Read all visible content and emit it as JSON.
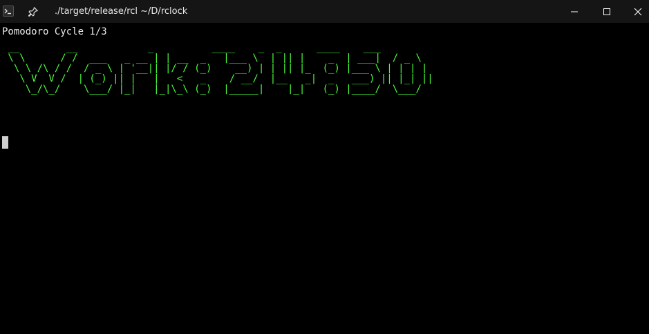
{
  "window": {
    "title": "./target/release/rcl ~/D/rclock",
    "icons": {
      "app": "terminal-app-icon",
      "pin": "pin-icon",
      "minimize": "minimize-icon",
      "maximize": "maximize-icon",
      "close": "close-icon"
    }
  },
  "terminal": {
    "status_line": "Pomodoro Cycle 1/3",
    "big_clock_lines": [
      " __        __            _          ____    _  _      ____    ___ ",
      " \\ \\      / /  ___   _ __ | | __  _   |___ \\  | || |    _  | ___|  / _ \\",
      "  \\ \\ /\\ / /  / _ \\ | '__|| |/ / (_)    __) | | || |_  (_) |___ \\ | | | |",
      "   \\ V  V /  | (_) || |   |   <   _    / __/  |__   _|  _   ___) || |_| ||",
      "    \\_/\\_/    \\___/ |_|   |_|\\_\\ (_)  |_____|    |_|   (_) |____/  \\___/"
    ],
    "colors": {
      "background": "#000000",
      "clock_text": "#4cff3c",
      "status_text": "#ececec",
      "cursor": "#cfcfcf"
    }
  }
}
